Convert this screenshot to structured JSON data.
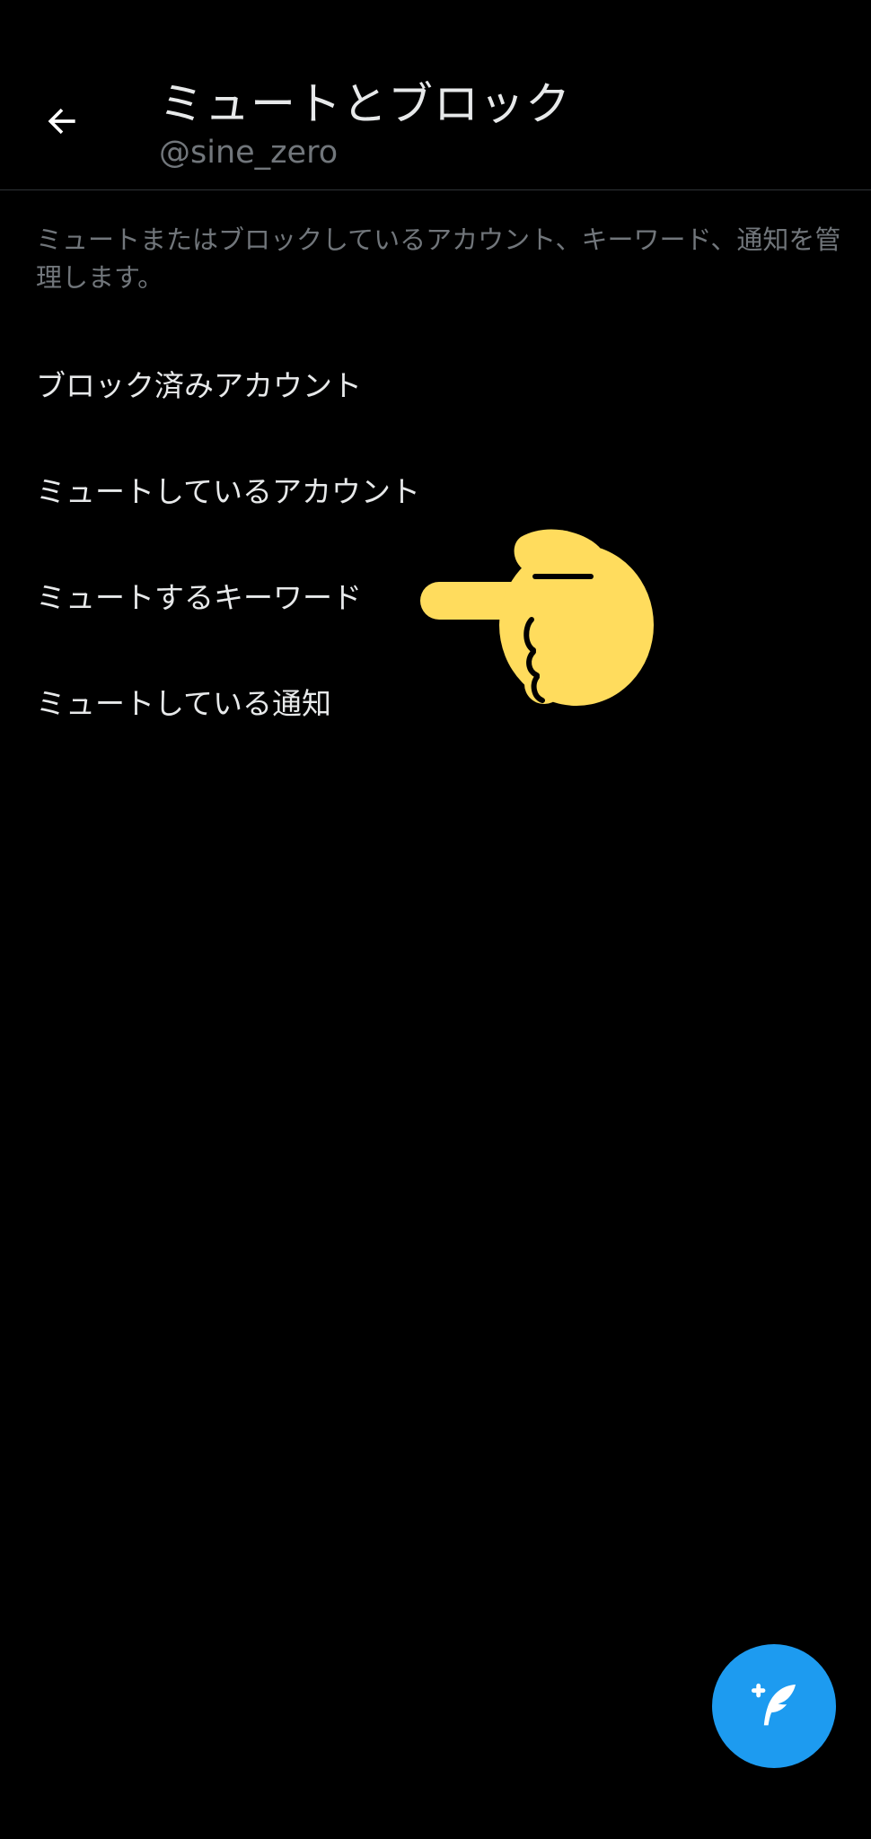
{
  "header": {
    "title": "ミュートとブロック",
    "subtitle": "@sine_zero"
  },
  "description": "ミュートまたはブロックしているアカウント、キーワード、通知を管理します。",
  "menu": {
    "items": [
      {
        "label": "ブロック済みアカウント"
      },
      {
        "label": "ミュートしているアカウント"
      },
      {
        "label": "ミュートするキーワード"
      },
      {
        "label": "ミュートしている通知"
      }
    ]
  },
  "icons": {
    "back": "arrow-left-icon",
    "pointer": "pointing-hand-icon",
    "compose": "feather-plus-icon"
  },
  "colors": {
    "background": "#000000",
    "primary_text": "#e7e9ea",
    "secondary_text": "#71767b",
    "accent": "#1d9bf0",
    "hand": "#ffdc5d"
  }
}
